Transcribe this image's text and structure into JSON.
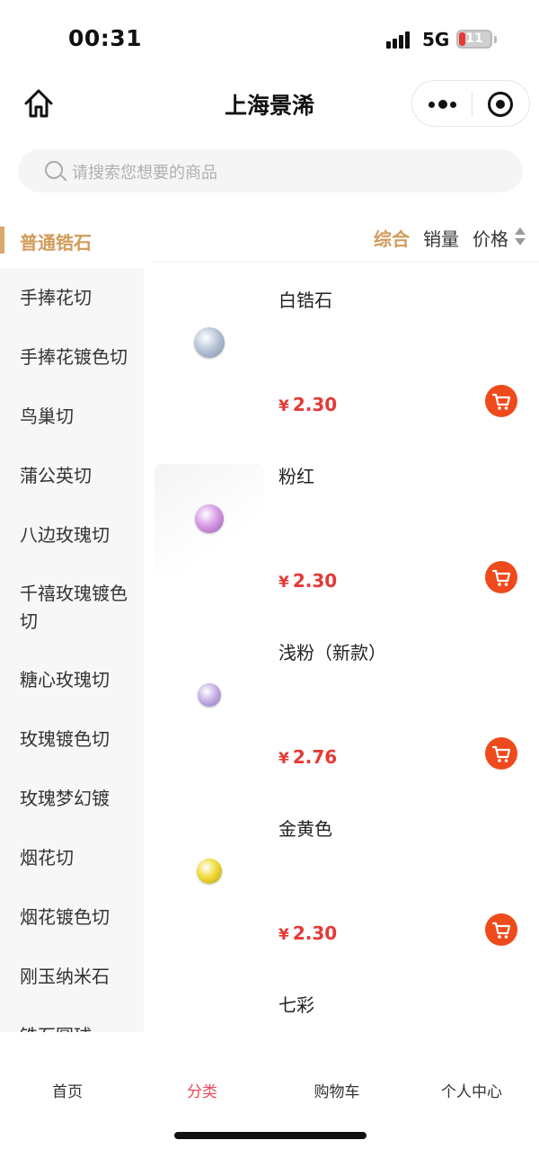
{
  "status_bar": {
    "time": "00:31",
    "network": "5G",
    "battery": "11"
  },
  "nav": {
    "title": "上海景浠"
  },
  "search": {
    "placeholder": "请搜索您想要的商品"
  },
  "sidebar": {
    "active": "普通锆石",
    "items": [
      {
        "label": "手捧花切"
      },
      {
        "label": "手捧花镀色切"
      },
      {
        "label": "鸟巢切"
      },
      {
        "label": "蒲公英切"
      },
      {
        "label": "八边玫瑰切"
      },
      {
        "label": "千禧玫瑰镀色切"
      },
      {
        "label": "糖心玫瑰切"
      },
      {
        "label": "玫瑰镀色切"
      },
      {
        "label": "玫瑰梦幻镀"
      },
      {
        "label": "烟花切"
      },
      {
        "label": "烟花镀色切"
      },
      {
        "label": "刚玉纳米石"
      },
      {
        "label": "锆石圆球"
      }
    ]
  },
  "sort": {
    "overall": "综合",
    "sales": "销量",
    "price": "价格"
  },
  "products": [
    {
      "name": "白锆石",
      "currency": "¥",
      "price": "2.30",
      "gem_color": "#b9c6d8",
      "gem_edge": "#7d8ea6"
    },
    {
      "name": "粉红",
      "currency": "¥",
      "price": "2.30",
      "gem_color": "#d79be6",
      "gem_edge": "#9c5ab6"
    },
    {
      "name": "浅粉（新款）",
      "currency": "¥",
      "price": "2.76",
      "gem_color": "#c8b2e6",
      "gem_edge": "#8d74b8"
    },
    {
      "name": "金黄色",
      "currency": "¥",
      "price": "2.30",
      "gem_color": "#f1dc3a",
      "gem_edge": "#b59e15"
    },
    {
      "name": "七彩",
      "currency": "¥",
      "price": "",
      "gem_color": "#ffffff",
      "gem_edge": "#ffffff"
    }
  ],
  "tabs": [
    {
      "label": "首页"
    },
    {
      "label": "分类"
    },
    {
      "label": "购物车"
    },
    {
      "label": "个人中心"
    }
  ],
  "colors": {
    "accent": "#d29b5a",
    "price": "#e53935",
    "cart": "#ef4a1c",
    "tab_active": "#ea4a56"
  }
}
